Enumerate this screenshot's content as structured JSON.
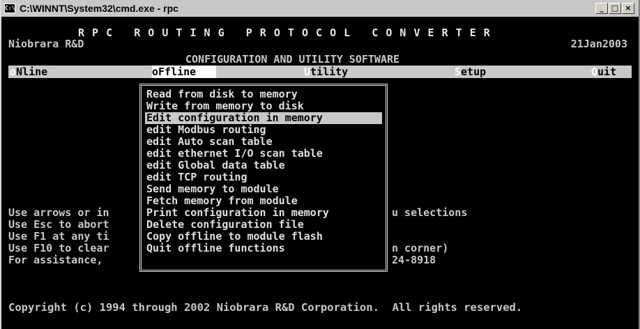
{
  "window": {
    "title": "C:\\WINNT\\System32\\cmd.exe - rpc",
    "buttons": {
      "minimize": "_",
      "maximize": "□",
      "close": "×"
    }
  },
  "header": {
    "banner": "R P C   R O U T I N G   P R O T O C O L   C O N V E R T E R",
    "company": "Niobrara R&D",
    "date": "21Jan2003",
    "subtitle": "CONFIGURATION AND UTILITY SOFTWARE"
  },
  "menubar": {
    "items": [
      {
        "hotkey": "o",
        "label": "Nline"
      },
      {
        "hotkey": "o",
        "label": "Ffline"
      },
      {
        "hotkey": "U",
        "label": "tility"
      },
      {
        "hotkey": "S",
        "label": "etup"
      },
      {
        "hotkey": "Q",
        "label": "uit"
      }
    ]
  },
  "dropdown": {
    "items": [
      "Read from disk to memory",
      "Write from memory to disk",
      "Edit configuration in memory",
      "edit Modbus routing",
      "edit Auto scan table",
      "edit ethernet I/O scan table",
      "edit Global data table",
      "edit TCP routing",
      "Send memory to module",
      "Fetch memory from module",
      "Print configuration in memory",
      "Delete configuration file",
      "Copy offline to module flash",
      "Quit offline functions"
    ],
    "selected_index": 2
  },
  "help": {
    "left": [
      "Use arrows or in",
      "Use Esc to abort",
      "Use F1 at any ti",
      "Use F10 to clear",
      "For assistance,"
    ],
    "right": [
      "u selections",
      "",
      "",
      "n corner)",
      "24-8918"
    ]
  },
  "footer": {
    "copyright": "Copyright (c) 1994 through 2002 Niobrara R&D Corporation.  All rights reserved."
  }
}
